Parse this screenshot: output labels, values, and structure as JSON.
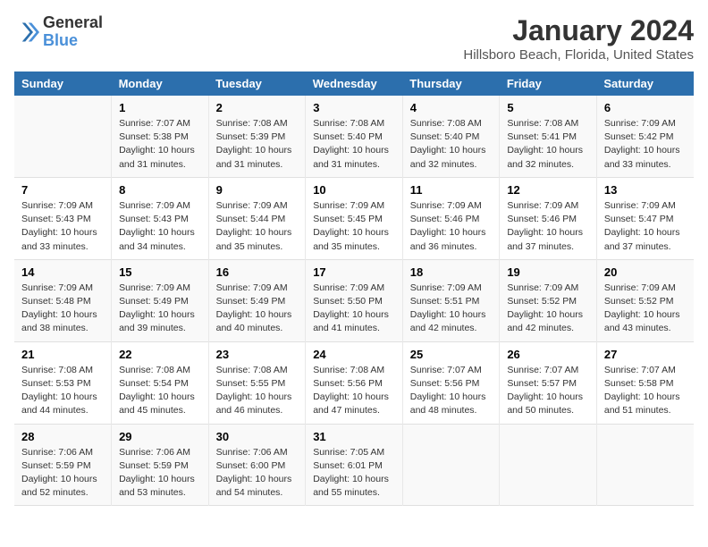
{
  "logo": {
    "line1": "General",
    "line2": "Blue"
  },
  "title": "January 2024",
  "subtitle": "Hillsboro Beach, Florida, United States",
  "days_of_week": [
    "Sunday",
    "Monday",
    "Tuesday",
    "Wednesday",
    "Thursday",
    "Friday",
    "Saturday"
  ],
  "weeks": [
    [
      {
        "num": "",
        "sunrise": "",
        "sunset": "",
        "daylight": ""
      },
      {
        "num": "1",
        "sunrise": "Sunrise: 7:07 AM",
        "sunset": "Sunset: 5:38 PM",
        "daylight": "Daylight: 10 hours and 31 minutes."
      },
      {
        "num": "2",
        "sunrise": "Sunrise: 7:08 AM",
        "sunset": "Sunset: 5:39 PM",
        "daylight": "Daylight: 10 hours and 31 minutes."
      },
      {
        "num": "3",
        "sunrise": "Sunrise: 7:08 AM",
        "sunset": "Sunset: 5:40 PM",
        "daylight": "Daylight: 10 hours and 31 minutes."
      },
      {
        "num": "4",
        "sunrise": "Sunrise: 7:08 AM",
        "sunset": "Sunset: 5:40 PM",
        "daylight": "Daylight: 10 hours and 32 minutes."
      },
      {
        "num": "5",
        "sunrise": "Sunrise: 7:08 AM",
        "sunset": "Sunset: 5:41 PM",
        "daylight": "Daylight: 10 hours and 32 minutes."
      },
      {
        "num": "6",
        "sunrise": "Sunrise: 7:09 AM",
        "sunset": "Sunset: 5:42 PM",
        "daylight": "Daylight: 10 hours and 33 minutes."
      }
    ],
    [
      {
        "num": "7",
        "sunrise": "Sunrise: 7:09 AM",
        "sunset": "Sunset: 5:43 PM",
        "daylight": "Daylight: 10 hours and 33 minutes."
      },
      {
        "num": "8",
        "sunrise": "Sunrise: 7:09 AM",
        "sunset": "Sunset: 5:43 PM",
        "daylight": "Daylight: 10 hours and 34 minutes."
      },
      {
        "num": "9",
        "sunrise": "Sunrise: 7:09 AM",
        "sunset": "Sunset: 5:44 PM",
        "daylight": "Daylight: 10 hours and 35 minutes."
      },
      {
        "num": "10",
        "sunrise": "Sunrise: 7:09 AM",
        "sunset": "Sunset: 5:45 PM",
        "daylight": "Daylight: 10 hours and 35 minutes."
      },
      {
        "num": "11",
        "sunrise": "Sunrise: 7:09 AM",
        "sunset": "Sunset: 5:46 PM",
        "daylight": "Daylight: 10 hours and 36 minutes."
      },
      {
        "num": "12",
        "sunrise": "Sunrise: 7:09 AM",
        "sunset": "Sunset: 5:46 PM",
        "daylight": "Daylight: 10 hours and 37 minutes."
      },
      {
        "num": "13",
        "sunrise": "Sunrise: 7:09 AM",
        "sunset": "Sunset: 5:47 PM",
        "daylight": "Daylight: 10 hours and 37 minutes."
      }
    ],
    [
      {
        "num": "14",
        "sunrise": "Sunrise: 7:09 AM",
        "sunset": "Sunset: 5:48 PM",
        "daylight": "Daylight: 10 hours and 38 minutes."
      },
      {
        "num": "15",
        "sunrise": "Sunrise: 7:09 AM",
        "sunset": "Sunset: 5:49 PM",
        "daylight": "Daylight: 10 hours and 39 minutes."
      },
      {
        "num": "16",
        "sunrise": "Sunrise: 7:09 AM",
        "sunset": "Sunset: 5:49 PM",
        "daylight": "Daylight: 10 hours and 40 minutes."
      },
      {
        "num": "17",
        "sunrise": "Sunrise: 7:09 AM",
        "sunset": "Sunset: 5:50 PM",
        "daylight": "Daylight: 10 hours and 41 minutes."
      },
      {
        "num": "18",
        "sunrise": "Sunrise: 7:09 AM",
        "sunset": "Sunset: 5:51 PM",
        "daylight": "Daylight: 10 hours and 42 minutes."
      },
      {
        "num": "19",
        "sunrise": "Sunrise: 7:09 AM",
        "sunset": "Sunset: 5:52 PM",
        "daylight": "Daylight: 10 hours and 42 minutes."
      },
      {
        "num": "20",
        "sunrise": "Sunrise: 7:09 AM",
        "sunset": "Sunset: 5:52 PM",
        "daylight": "Daylight: 10 hours and 43 minutes."
      }
    ],
    [
      {
        "num": "21",
        "sunrise": "Sunrise: 7:08 AM",
        "sunset": "Sunset: 5:53 PM",
        "daylight": "Daylight: 10 hours and 44 minutes."
      },
      {
        "num": "22",
        "sunrise": "Sunrise: 7:08 AM",
        "sunset": "Sunset: 5:54 PM",
        "daylight": "Daylight: 10 hours and 45 minutes."
      },
      {
        "num": "23",
        "sunrise": "Sunrise: 7:08 AM",
        "sunset": "Sunset: 5:55 PM",
        "daylight": "Daylight: 10 hours and 46 minutes."
      },
      {
        "num": "24",
        "sunrise": "Sunrise: 7:08 AM",
        "sunset": "Sunset: 5:56 PM",
        "daylight": "Daylight: 10 hours and 47 minutes."
      },
      {
        "num": "25",
        "sunrise": "Sunrise: 7:07 AM",
        "sunset": "Sunset: 5:56 PM",
        "daylight": "Daylight: 10 hours and 48 minutes."
      },
      {
        "num": "26",
        "sunrise": "Sunrise: 7:07 AM",
        "sunset": "Sunset: 5:57 PM",
        "daylight": "Daylight: 10 hours and 50 minutes."
      },
      {
        "num": "27",
        "sunrise": "Sunrise: 7:07 AM",
        "sunset": "Sunset: 5:58 PM",
        "daylight": "Daylight: 10 hours and 51 minutes."
      }
    ],
    [
      {
        "num": "28",
        "sunrise": "Sunrise: 7:06 AM",
        "sunset": "Sunset: 5:59 PM",
        "daylight": "Daylight: 10 hours and 52 minutes."
      },
      {
        "num": "29",
        "sunrise": "Sunrise: 7:06 AM",
        "sunset": "Sunset: 5:59 PM",
        "daylight": "Daylight: 10 hours and 53 minutes."
      },
      {
        "num": "30",
        "sunrise": "Sunrise: 7:06 AM",
        "sunset": "Sunset: 6:00 PM",
        "daylight": "Daylight: 10 hours and 54 minutes."
      },
      {
        "num": "31",
        "sunrise": "Sunrise: 7:05 AM",
        "sunset": "Sunset: 6:01 PM",
        "daylight": "Daylight: 10 hours and 55 minutes."
      },
      {
        "num": "",
        "sunrise": "",
        "sunset": "",
        "daylight": ""
      },
      {
        "num": "",
        "sunrise": "",
        "sunset": "",
        "daylight": ""
      },
      {
        "num": "",
        "sunrise": "",
        "sunset": "",
        "daylight": ""
      }
    ]
  ]
}
